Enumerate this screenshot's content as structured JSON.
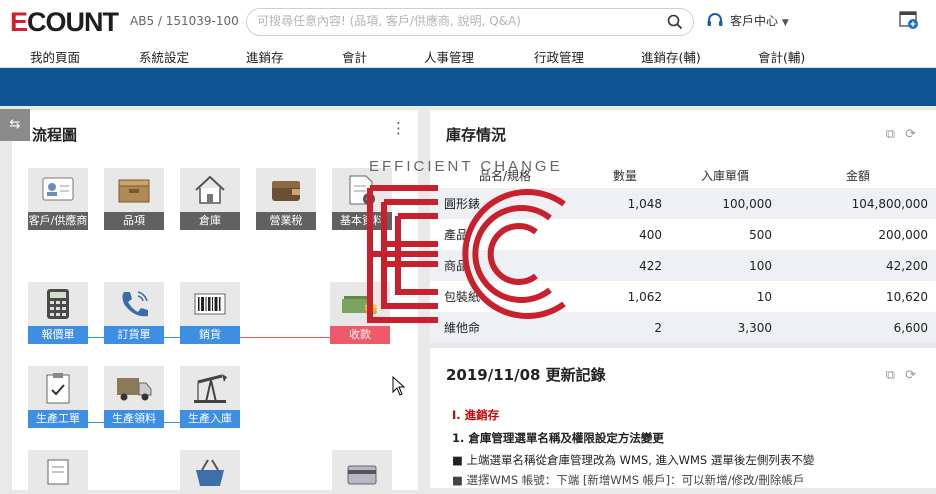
{
  "header": {
    "logo": "ECOUNT",
    "company_code": "AB5 / 151039-100",
    "search_placeholder": "可搜尋任意內容! (品項, 客戶/供應商, 說明, Q&A)",
    "support_label": "客戶中心"
  },
  "menu": [
    "我的頁面",
    "系統設定",
    "進銷存",
    "會計",
    "人事管理",
    "行政管理",
    "進銷存(輔)",
    "會計(輔)"
  ],
  "flow_panel": {
    "title": "流程圖",
    "items": [
      {
        "label": "客戶/供應商",
        "icon": "contact-card-icon",
        "style": "gray"
      },
      {
        "label": "品項",
        "icon": "box-icon",
        "style": "gray"
      },
      {
        "label": "倉庫",
        "icon": "house-icon",
        "style": "gray"
      },
      {
        "label": "營業稅",
        "icon": "wallet-icon",
        "style": "gray"
      },
      {
        "label": "基本資料",
        "icon": "document-gear-icon",
        "style": "gray"
      },
      {
        "label": "報價單",
        "icon": "calculator-icon",
        "style": "blue"
      },
      {
        "label": "訂貨單",
        "icon": "phone-icon",
        "style": "blue"
      },
      {
        "label": "銷貨",
        "icon": "barcode-icon",
        "style": "blue"
      },
      {
        "label": "收款",
        "icon": "cash-coins-icon",
        "style": "red"
      },
      {
        "label": "生產工單",
        "icon": "clipboard-check-icon",
        "style": "blue"
      },
      {
        "label": "生產領料",
        "icon": "truck-icon",
        "style": "blue"
      },
      {
        "label": "生產入庫",
        "icon": "oil-pump-icon",
        "style": "blue"
      }
    ],
    "connector_colors": {
      "blue": "#3e8ee4",
      "red": "#ef5a6a"
    }
  },
  "stock_panel": {
    "title": "庫存情況",
    "columns": [
      "品名/規格",
      "數量",
      "入庫單價",
      "金額"
    ],
    "rows": [
      [
        "圓形錶",
        "1,048",
        "100,000",
        "104,800,000"
      ],
      [
        "產品",
        "400",
        "500",
        "200,000"
      ],
      [
        "商品",
        "422",
        "100",
        "42,200"
      ],
      [
        "包裝紙",
        "1,062",
        "10",
        "10,620"
      ],
      [
        "維他命",
        "2",
        "3,300",
        "6,600"
      ]
    ]
  },
  "update_panel": {
    "title": "2019/11/08 更新記錄",
    "section": "Ⅰ. 進銷存",
    "line1": "1. 倉庫管理選單名稱及權限設定方法變更",
    "line2": "■ 上端選單名稱從倉庫管理改為 WMS, 進入WMS 選單後左側列表不變",
    "line3": "■ 選擇WMS 帳號：下端 [新增WMS 帳戶]：可以新增/修改/刪除帳戶"
  },
  "overlay": {
    "tagline": "EFFICIENT CHANGE",
    "mark": "EC",
    "color": "#c8202d"
  },
  "colors": {
    "brand_blue": "#0f5493",
    "logo_red": "#d31f2a"
  }
}
